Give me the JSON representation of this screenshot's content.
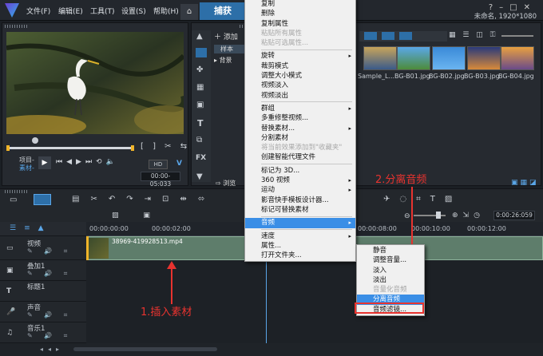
{
  "app": {
    "project_info": "未命名, 1920*1080"
  },
  "menubar": [
    "文件(F)",
    "编辑(E)",
    "工具(T)",
    "设置(S)",
    "帮助(H)"
  ],
  "tabs": {
    "home_icon": "home-icon",
    "capture": "捕获"
  },
  "player": {
    "project_label": "项目-",
    "clip_label": "素材-",
    "timecode": "00:00-05:033",
    "mode": "HD",
    "v_label": "V"
  },
  "library": {
    "add_label": "添加",
    "folders": [
      "样本",
      "背景"
    ],
    "thumbs": [
      "Sample_L...",
      "BG-B01.jpg",
      "BG-B02.jpg",
      "BG-B03.jpg",
      "BG-B04.jpg"
    ],
    "browse": "浏览"
  },
  "timeline": {
    "ruler": [
      "00:00:00:00",
      "00:00:02:00",
      "00:00:08:00",
      "00:00:10:00",
      "00:00:12:00"
    ],
    "timecode": "0:00:26:059",
    "clip_name": "38969-419928513.mp4",
    "tracks": [
      "视频",
      "叠加1",
      "标题1",
      "声音",
      "音乐1"
    ]
  },
  "context_menu": {
    "items": [
      {
        "label": "复制",
        "state": "normal"
      },
      {
        "label": "删除",
        "state": "normal"
      },
      {
        "label": "复制属性",
        "state": "normal"
      },
      {
        "label": "粘贴所有属性",
        "state": "disabled"
      },
      {
        "label": "粘贴可选属性...",
        "state": "disabled"
      },
      {
        "sep": true
      },
      {
        "label": "旋转",
        "state": "normal",
        "sub": true
      },
      {
        "label": "裁剪模式",
        "state": "normal"
      },
      {
        "label": "调整大小模式",
        "state": "normal"
      },
      {
        "label": "视频淡入",
        "state": "normal"
      },
      {
        "label": "视频淡出",
        "state": "normal"
      },
      {
        "sep": true
      },
      {
        "label": "群组",
        "state": "normal",
        "sub": true
      },
      {
        "label": "多重修整视频...",
        "state": "normal"
      },
      {
        "label": "替换素材...",
        "state": "normal",
        "sub": true
      },
      {
        "label": "分割素材",
        "state": "normal"
      },
      {
        "label": "将当前效果添加到\"收藏夹\"",
        "state": "disabled"
      },
      {
        "label": "创建智能代理文件",
        "state": "normal"
      },
      {
        "sep": true
      },
      {
        "label": "标记为 3D...",
        "state": "normal"
      },
      {
        "label": "360 视频",
        "state": "normal",
        "sub": true
      },
      {
        "label": "运动",
        "state": "normal",
        "sub": true
      },
      {
        "label": "影音快手模板设计器...",
        "state": "normal"
      },
      {
        "label": "标记可替换素材",
        "state": "normal"
      },
      {
        "sep": true
      },
      {
        "label": "音频",
        "state": "selected",
        "sub": true
      },
      {
        "sep": true
      },
      {
        "label": "速度",
        "state": "normal",
        "sub": true
      },
      {
        "label": "属性...",
        "state": "normal"
      },
      {
        "label": "打开文件夹...",
        "state": "normal"
      }
    ]
  },
  "audio_submenu": {
    "items": [
      {
        "label": "静音",
        "state": "normal"
      },
      {
        "label": "调整音量...",
        "state": "normal"
      },
      {
        "label": "淡入",
        "state": "normal"
      },
      {
        "label": "淡出",
        "state": "normal"
      },
      {
        "label": "音量化音频",
        "state": "disabled"
      },
      {
        "label": "分离音频",
        "state": "selected"
      },
      {
        "label": "音频滤镜...",
        "state": "normal"
      }
    ]
  },
  "annotations": {
    "insert": "1.插入素材",
    "split": "2.分离音频"
  },
  "colors": {
    "accent": "#3a8ee6",
    "annotation": "#e8332f",
    "clip": "#5e7d6b"
  }
}
